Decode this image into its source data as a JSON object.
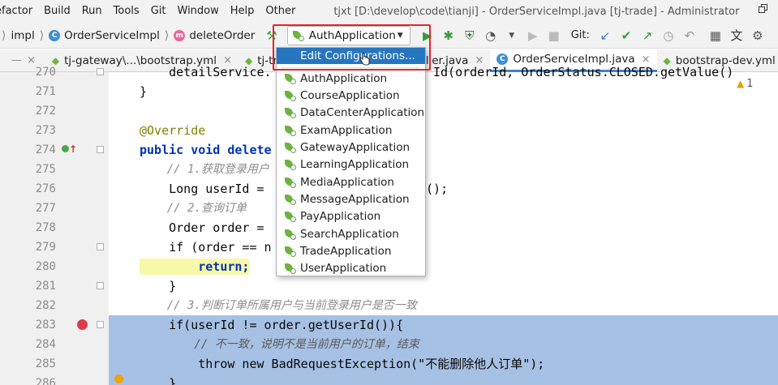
{
  "menubar": {
    "items": [
      "efactor",
      "Build",
      "Run",
      "Tools",
      "Git",
      "Window",
      "Help",
      "Other"
    ],
    "window_title": "tjxt [D:\\develop\\code\\tianji] - OrderServiceImpl.java [tj-trade] - Administrator"
  },
  "navbar": {
    "crumbs": [
      {
        "label": "impl",
        "icon": "none"
      },
      {
        "label": "OrderServiceImpl",
        "icon": "class-icon",
        "badge": "C"
      },
      {
        "label": "deleteOrder",
        "icon": "method-icon",
        "badge": "m"
      }
    ],
    "run_config": "AuthApplication",
    "git_label": "Git:"
  },
  "tabs": [
    {
      "label": "tj-gateway\\...\\bootstrap.yml",
      "icon": "yaml-icon",
      "active": false
    },
    {
      "label": "tj-trade\\",
      "icon": "yaml-icon",
      "active": false
    },
    {
      "label": "Controller.java",
      "icon": "class-icon",
      "active": false
    },
    {
      "label": "OrderServiceImpl.java",
      "icon": "class-icon",
      "active": true
    },
    {
      "label": "bootstrap-dev.yml",
      "icon": "yaml-icon",
      "active": false
    }
  ],
  "dropdown": {
    "edit_label": "Edit Configurations...",
    "items": [
      "AuthApplication",
      "CourseApplication",
      "DataCenterApplication",
      "ExamApplication",
      "GatewayApplication",
      "LearningApplication",
      "MediaApplication",
      "MessageApplication",
      "PayApplication",
      "SearchApplication",
      "TradeApplication",
      "UserApplication"
    ]
  },
  "editor": {
    "warning_count": "1",
    "lines": [
      {
        "n": "270",
        "code": "    detailService."
      },
      {
        "n": "271",
        "code": "}"
      },
      {
        "n": "272",
        "code": ""
      },
      {
        "n": "273",
        "code": "@Override"
      },
      {
        "n": "274",
        "code": "public void delete"
      },
      {
        "n": "275",
        "code": "    // 1.获取登录用户"
      },
      {
        "n": "276",
        "code": "    Long userId = "
      },
      {
        "n": "277",
        "code": "    // 2.查询订单"
      },
      {
        "n": "278",
        "code": "    Order order = "
      },
      {
        "n": "279",
        "code": "    if (order == n"
      },
      {
        "n": "280",
        "code": "        return;"
      },
      {
        "n": "281",
        "code": "    }"
      },
      {
        "n": "282",
        "code": "    // 3.判断订单所属用户与当前登录用户是否一致"
      },
      {
        "n": "283",
        "code": "    if(userId != order.getUserId()){"
      },
      {
        "n": "284",
        "code": "        // 不一致，说明不是当前用户的订单，结束"
      },
      {
        "n": "285",
        "code": "        throw new BadRequestException(\"不能删除他人订单\");"
      },
      {
        "n": "286",
        "code": "    }"
      }
    ],
    "behind_popup": {
      "line270_right": "Id(orderId, OrderStatus.CLOSED.getValue()",
      "line276_right": "r();"
    }
  }
}
